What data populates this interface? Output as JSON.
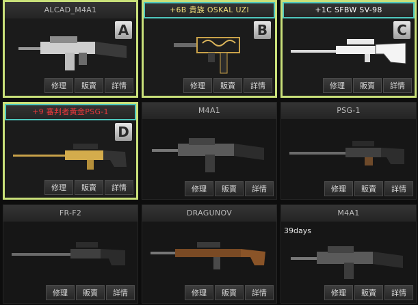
{
  "buttons": {
    "repair": "修理",
    "sell": "販賣",
    "details": "詳情"
  },
  "items": [
    {
      "name": "ALCAD_M4A1",
      "badge": "A",
      "days": ""
    },
    {
      "name": "+6B 貴族 OSKAL UZI",
      "badge": "B",
      "days": ""
    },
    {
      "name": "+1C SFBW SV-98",
      "badge": "C",
      "days": ""
    },
    {
      "name": "+9 審判者黃金PSG-1",
      "badge": "D",
      "days": ""
    },
    {
      "name": "M4A1",
      "badge": "",
      "days": ""
    },
    {
      "name": "PSG-1",
      "badge": "",
      "days": ""
    },
    {
      "name": "FR-F2",
      "badge": "",
      "days": ""
    },
    {
      "name": "DRAGUNOV",
      "badge": "",
      "days": ""
    },
    {
      "name": "M4A1",
      "badge": "",
      "days": "39days"
    }
  ],
  "colors": {
    "selected_border": "#c9e07a",
    "frame_cyan": "#4fc8bf",
    "name_red": "#e8383b",
    "name_yellow": "#f2e07a"
  }
}
